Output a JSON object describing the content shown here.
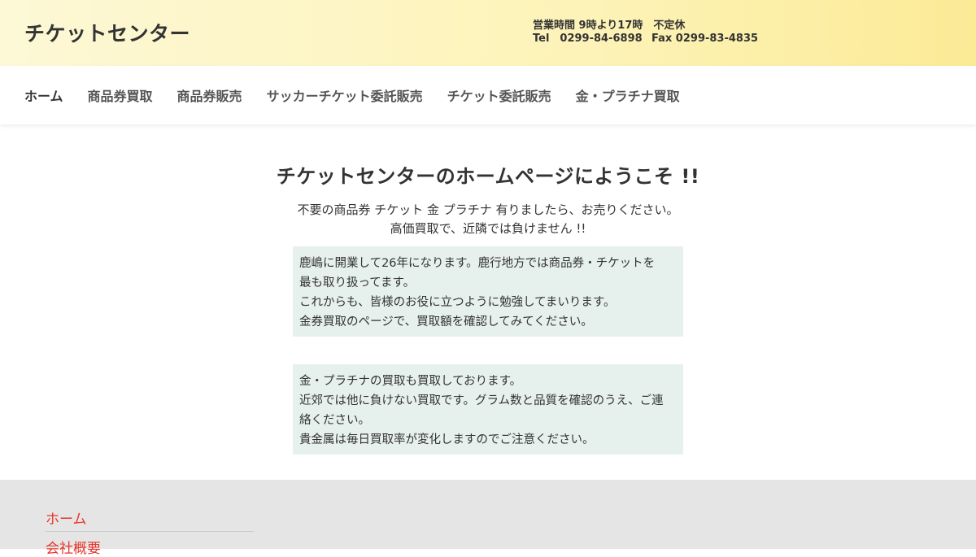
{
  "header": {
    "site_title": "チケットセンター",
    "hours": "営業時間 9時より17時　不定休",
    "tel": "Tel　0299-84-6898",
    "fax": "Fax 0299-83-4835"
  },
  "nav": {
    "items": [
      {
        "label": "ホーム"
      },
      {
        "label": "商品券買取"
      },
      {
        "label": "商品券販売"
      },
      {
        "label": "サッカーチケット委託販売"
      },
      {
        "label": "チケット委託販売"
      },
      {
        "label": "金・プラチナ買取"
      }
    ]
  },
  "main": {
    "heading": "チケットセンターのホームページにようこそ !!",
    "intro_line1": "不要の商品券 チケット 金 プラチナ 有りましたら、お売りください。",
    "intro_line2": "高価買取で、近隣では負けません !!",
    "box1": [
      "鹿嶋に開業して26年になります。鹿行地方では商品券・チケットを",
      "最も取り扱ってます。",
      "これからも、皆様のお役に立つように勉強してまいります。",
      "金券買取のページで、買取額を確認してみてください。"
    ],
    "box2": [
      "金・プラチナの買取も買取しております。",
      "近郊では他に負けない買取です。グラム数と品質を確認のうえ、ご連",
      "絡ください。",
      "貴金属は毎日買取率が変化しますのでご注意ください。"
    ]
  },
  "footer": {
    "links": [
      {
        "label": "ホーム"
      },
      {
        "label": "会社概要"
      }
    ]
  },
  "colors": {
    "footer_link": "#e8332a",
    "box_bg": "#e6f0ec",
    "header_gradient_end": "#fbea96"
  }
}
